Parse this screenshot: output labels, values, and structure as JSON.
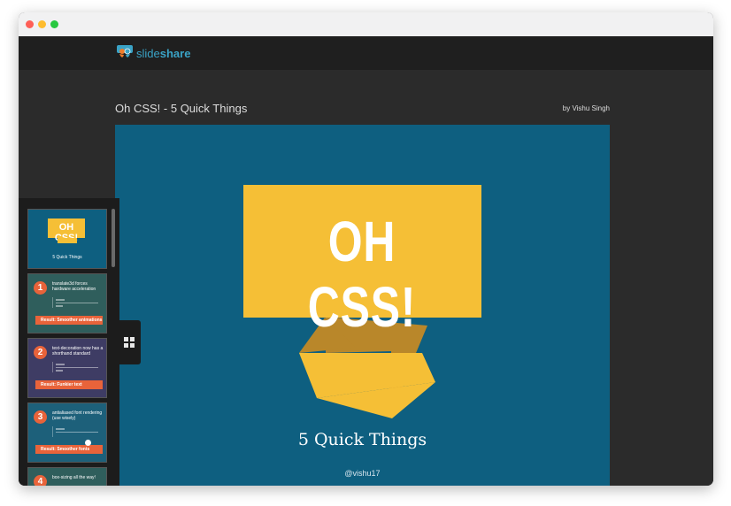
{
  "app": {
    "brand_part1": "slide",
    "brand_part2": "share"
  },
  "document": {
    "title": "Oh CSS! - 5 Quick Things",
    "author": "by Vishu Singh"
  },
  "slide": {
    "heading": "OH CSS!",
    "subtitle": "5 Quick Things",
    "handle": "@vishu17"
  },
  "colors": {
    "slide_bg": "#0e5f80",
    "banner": "#f5bf36",
    "banner_shadow": "#b9872a",
    "accent": "#e8633a",
    "brand": "#3aa3c6"
  },
  "thumbnails": [
    {
      "kind": "cover",
      "heading": "OH CSS!",
      "subtitle": "5 Quick Things",
      "bg": "#0e5f80"
    },
    {
      "kind": "tip",
      "number": "1",
      "text": "translate3d forces hardware acceleration",
      "result": "Result: Smoother animations",
      "bg": "#2f5e5c"
    },
    {
      "kind": "tip",
      "number": "2",
      "text": "text-decoration now has a shorthand standard",
      "result": "Result: Funkier text",
      "bg": "#3e3c64"
    },
    {
      "kind": "tip",
      "number": "3",
      "text": "antialiased font rendering (use wisely)",
      "result": "Result: Smoother fonts",
      "bg": "#1d607a"
    },
    {
      "kind": "tip",
      "number": "4",
      "text": "box-sizing all the way!",
      "result": "",
      "bg": "#2f5e5c"
    }
  ],
  "icons": {
    "logo": "slideshare-logo-icon",
    "grid_toggle": "grid-view-icon"
  }
}
